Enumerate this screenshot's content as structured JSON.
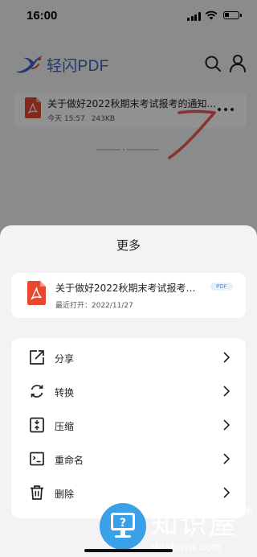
{
  "status_bar": {
    "time": "16:00"
  },
  "app": {
    "brand": "轻闪PDF",
    "recent_file": {
      "name": "关于做好2022秋期末考试报考的通知...",
      "date": "今天 15:57",
      "size": "243KB"
    }
  },
  "sheet": {
    "title": "更多",
    "file": {
      "name": "关于做好2022秋期末考试报考的...",
      "tag": "PDF",
      "opened": "最近打开：2022/11/27"
    },
    "actions": [
      {
        "label": "分享",
        "icon": "share-icon"
      },
      {
        "label": "转换",
        "icon": "convert-icon"
      },
      {
        "label": "压缩",
        "icon": "compress-icon"
      },
      {
        "label": "重命名",
        "icon": "rename-icon"
      },
      {
        "label": "删除",
        "icon": "delete-icon"
      }
    ]
  },
  "watermark": {
    "title": "知识屋",
    "mark": "®",
    "domain": "zhishiwu.com"
  },
  "colors": {
    "brand": "#3a63c7",
    "pdf_red": "#e8472f",
    "annotation": "#ee5a5a",
    "tag": "#4b8ee0"
  }
}
